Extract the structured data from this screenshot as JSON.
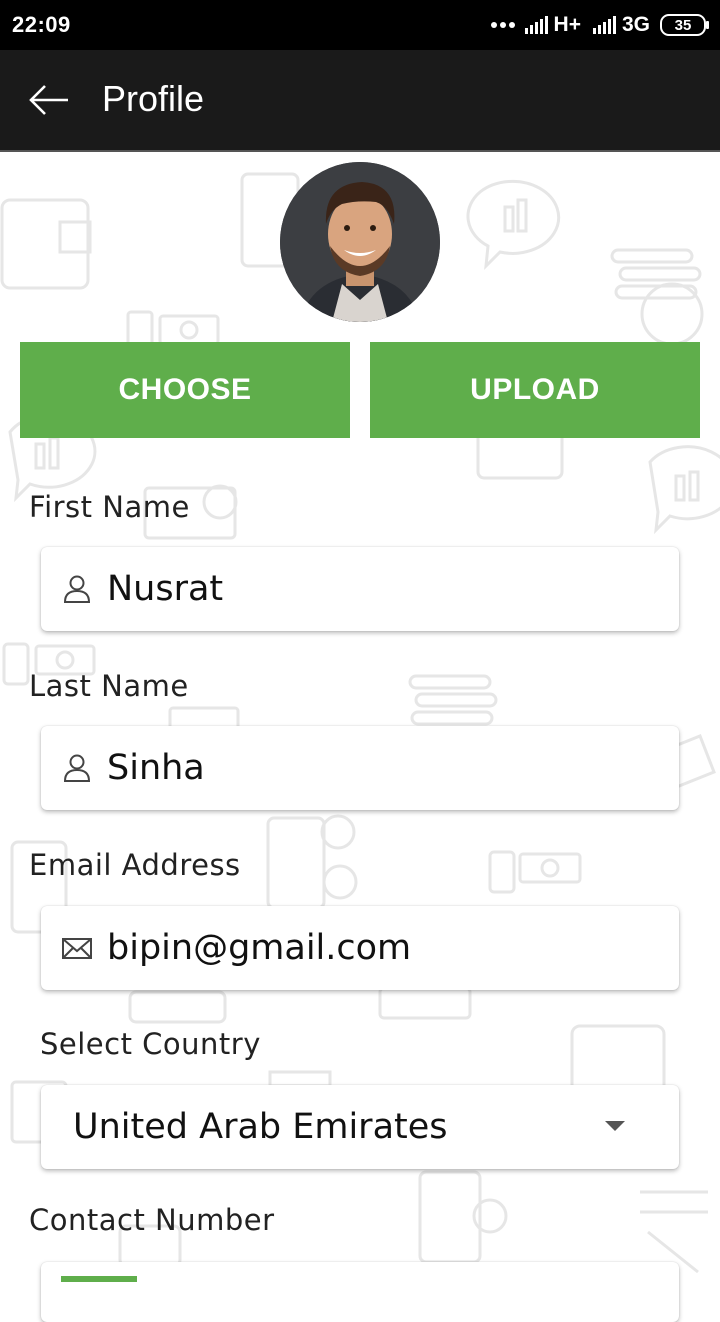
{
  "status_bar": {
    "time": "22:09",
    "network_1": "H+",
    "network_2": "3G",
    "battery": "35"
  },
  "app_bar": {
    "title": "Profile",
    "back_icon": "arrow-left-icon"
  },
  "photo_buttons": {
    "choose_label": "CHOOSE",
    "upload_label": "UPLOAD"
  },
  "form": {
    "first_name": {
      "label": "First Name",
      "value": "Nusrat",
      "icon": "person-icon"
    },
    "last_name": {
      "label": "Last Name",
      "value": "Sinha",
      "icon": "person-icon"
    },
    "email": {
      "label": "Email Address",
      "value": "bipin@gmail.com",
      "icon": "envelope-icon"
    },
    "country": {
      "label": "Select Country",
      "value": "United Arab Emirates"
    },
    "contact": {
      "label": "Contact Number"
    }
  },
  "colors": {
    "accent_green": "#5fae4b",
    "app_bar": "#1a1a1a",
    "status_bar": "#000000"
  }
}
